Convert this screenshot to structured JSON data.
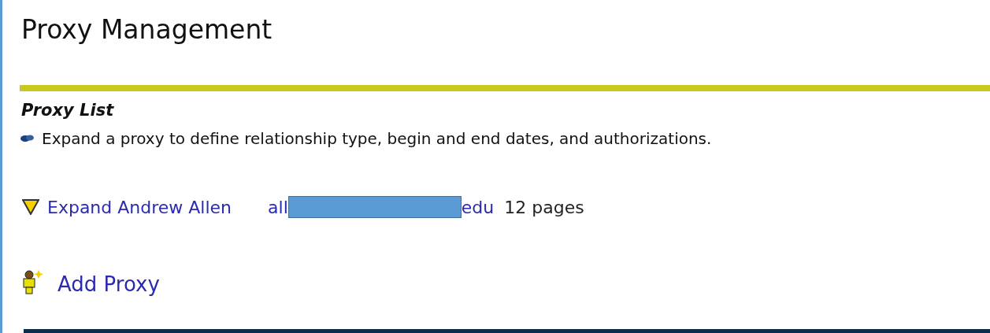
{
  "page": {
    "title": "Proxy Management"
  },
  "section": {
    "title": "Proxy List",
    "hint": "Expand a proxy to define relationship type, begin and end dates, and authorizations."
  },
  "proxies": [
    {
      "expand_label": "Expand Andrew Allen",
      "email_start": "all",
      "email_redacted": true,
      "email_end": "edu",
      "pages": "12 pages"
    }
  ],
  "add_link": "Add Proxy"
}
